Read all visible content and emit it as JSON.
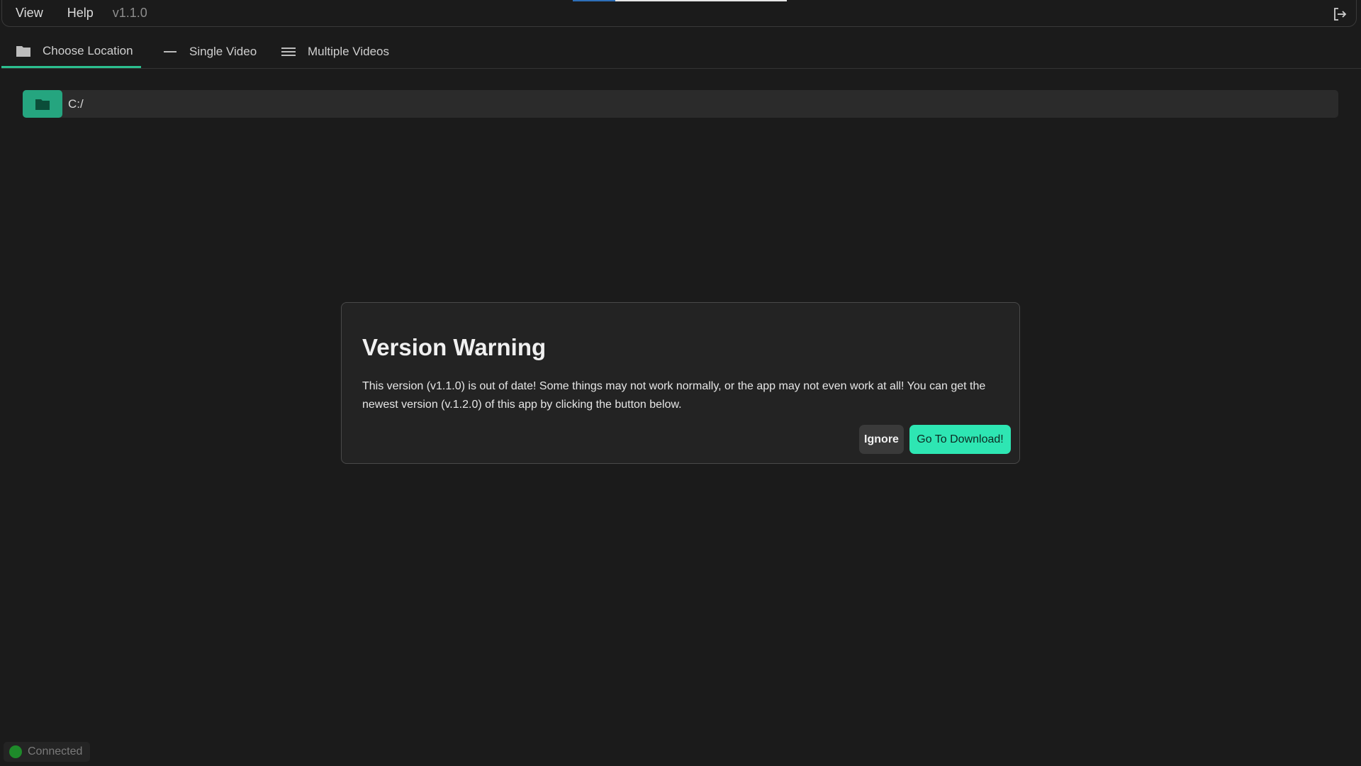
{
  "menubar": {
    "items": [
      {
        "label": "View"
      },
      {
        "label": "Help"
      }
    ],
    "version": "v1.1.0"
  },
  "tabs": [
    {
      "label": "Choose Location",
      "icon": "folder-icon",
      "active": true
    },
    {
      "label": "Single Video",
      "icon": "dash-icon",
      "active": false
    },
    {
      "label": "Multiple Videos",
      "icon": "list-icon",
      "active": false
    }
  ],
  "location": {
    "path": "C:/"
  },
  "dialog": {
    "title": "Version Warning",
    "body": "This version (v1.1.0) is out of date! Some things may not work normally, or the app may not even work at all! You can get the newest version (v.1.2.0) of this app by clicking the button below.",
    "ignore_label": "Ignore",
    "download_label": "Go To Download!"
  },
  "status": {
    "label": "Connected",
    "color": "#1e8a2a"
  },
  "colors": {
    "accent": "#2bbf8f",
    "download_button": "#2ee6b3",
    "background": "#1b1b1b"
  }
}
